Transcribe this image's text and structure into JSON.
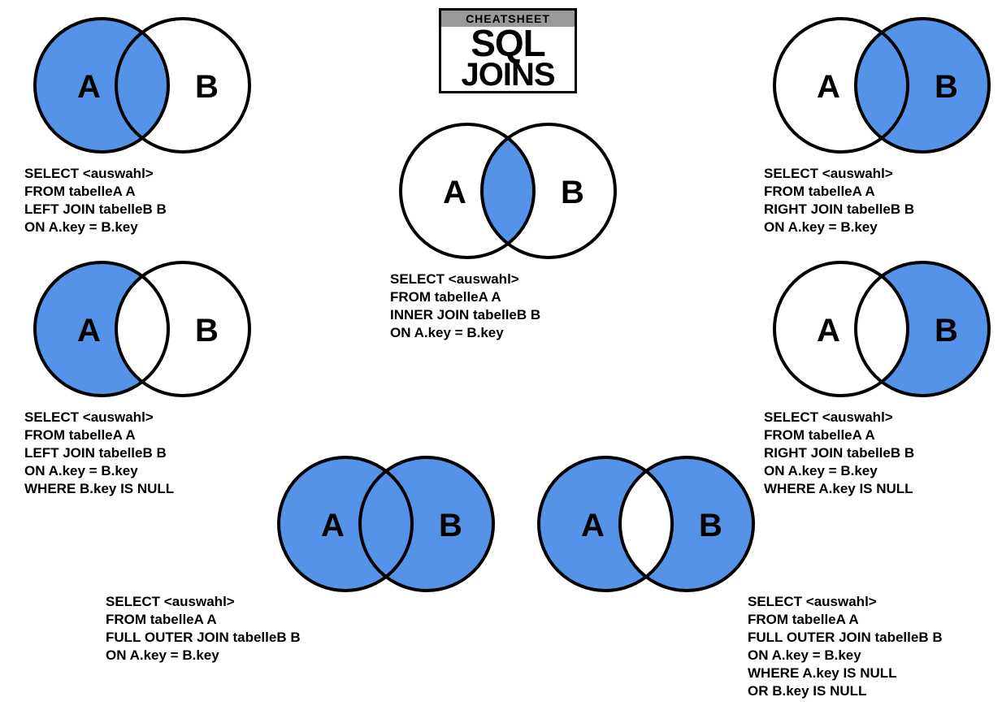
{
  "header": {
    "cheatsheet": "CHEATSHEET",
    "line1": "SQL",
    "line2": "JOINS"
  },
  "colors": {
    "fill": "#5493e8",
    "stroke": "#000"
  },
  "labels": {
    "a": "A",
    "b": "B"
  },
  "diagrams": {
    "left_join": {
      "code": "SELECT <auswahl>\nFROM tabelleA A\nLEFT JOIN tabelleB B\nON A.key = B.key"
    },
    "right_join": {
      "code": "SELECT <auswahl>\nFROM tabelleA A\nRIGHT JOIN tabelleB B\nON A.key = B.key"
    },
    "inner_join": {
      "code": "SELECT <auswahl>\nFROM tabelleA A\nINNER JOIN tabelleB B\nON A.key = B.key"
    },
    "left_join_exclude": {
      "code": "SELECT <auswahl>\nFROM tabelleA A\nLEFT JOIN tabelleB B\nON A.key = B.key\nWHERE B.key IS NULL"
    },
    "right_join_exclude": {
      "code": "SELECT <auswahl>\nFROM tabelleA A\nRIGHT JOIN tabelleB B\nON A.key = B.key\nWHERE A.key IS NULL"
    },
    "full_outer": {
      "code": "SELECT <auswahl>\nFROM tabelleA A\nFULL OUTER JOIN tabelleB B\nON A.key = B.key"
    },
    "full_outer_exclude": {
      "code": "SELECT <auswahl>\nFROM tabelleA A\nFULL OUTER JOIN tabelleB B\nON A.key = B.key\nWHERE A.key IS NULL\nOR B.key IS NULL"
    }
  }
}
